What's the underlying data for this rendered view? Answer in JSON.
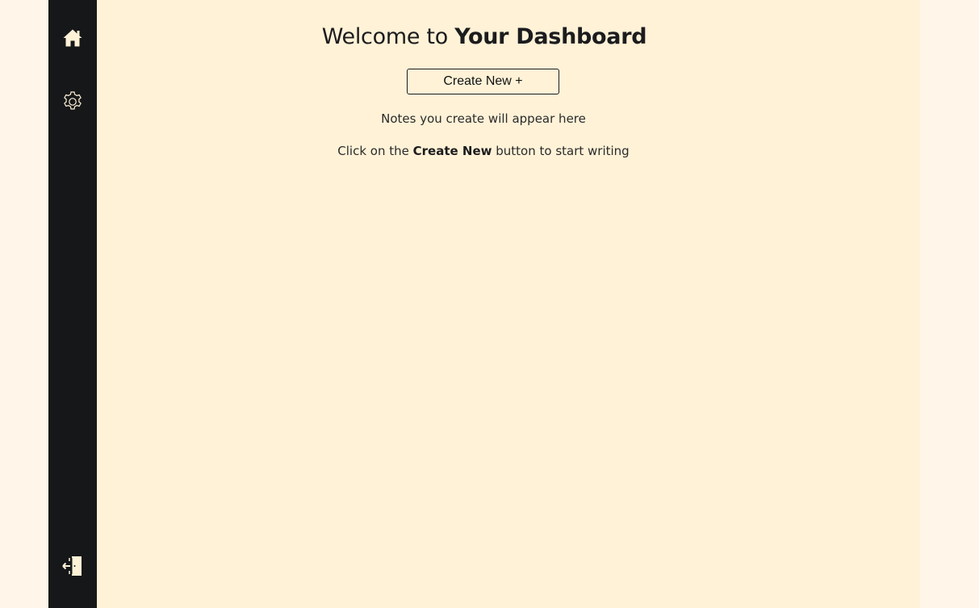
{
  "sidebar": {
    "items": [
      {
        "name": "home",
        "icon": "home-icon"
      },
      {
        "name": "settings",
        "icon": "gear-icon"
      }
    ],
    "logout": {
      "icon": "logout-door-icon"
    },
    "background": "#161719",
    "icon_color": "#fff2d7"
  },
  "main": {
    "title_prefix": "Welcome to ",
    "title_strong": "Your Dashboard",
    "create_button_label": "Create New +",
    "empty_line": "Notes you create will appear here",
    "hint_prefix": "Click on the ",
    "hint_strong": "Create New",
    "hint_suffix": " button to start writing",
    "background": "#fff2d7"
  }
}
